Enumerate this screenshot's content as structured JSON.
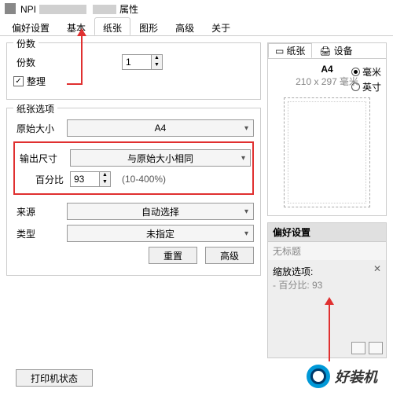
{
  "title": {
    "prefix": "NPI",
    "suffix": "属性"
  },
  "tabs": [
    "偏好设置",
    "基本",
    "纸张",
    "图形",
    "高级",
    "关于"
  ],
  "active_tab": 2,
  "copies": {
    "group": "份数",
    "label": "份数",
    "value": "1",
    "collate_label": "整理",
    "collate_checked": true
  },
  "paper_options": {
    "group": "纸张选项",
    "orig_size_label": "原始大小",
    "orig_size_value": "A4",
    "output_label": "输出尺寸",
    "output_value": "与原始大小相同",
    "percent_label": "百分比",
    "percent_value": "93",
    "percent_hint": "(10-400%)",
    "source_label": "来源",
    "source_value": "自动选择",
    "type_label": "类型",
    "type_value": "未指定",
    "reset_btn": "重置",
    "advanced_btn": "高级"
  },
  "right": {
    "subtabs": [
      {
        "icon": "paper-icon",
        "label": "纸张"
      },
      {
        "icon": "device-icon",
        "label": "设备"
      }
    ],
    "active_subtab": 0,
    "paper_name": "A4",
    "paper_dim": "210 x 297",
    "paper_unit": "毫米",
    "units": [
      {
        "label": "毫米",
        "on": true
      },
      {
        "label": "英寸",
        "on": false
      }
    ],
    "pref": {
      "title": "偏好设置",
      "subtitle": "无标题",
      "scale_head": "缩放选项:",
      "scale_line": "- 百分比: 93"
    }
  },
  "footer": {
    "printer_status": "打印机状态"
  },
  "watermark": "好装机",
  "chart_data": null
}
